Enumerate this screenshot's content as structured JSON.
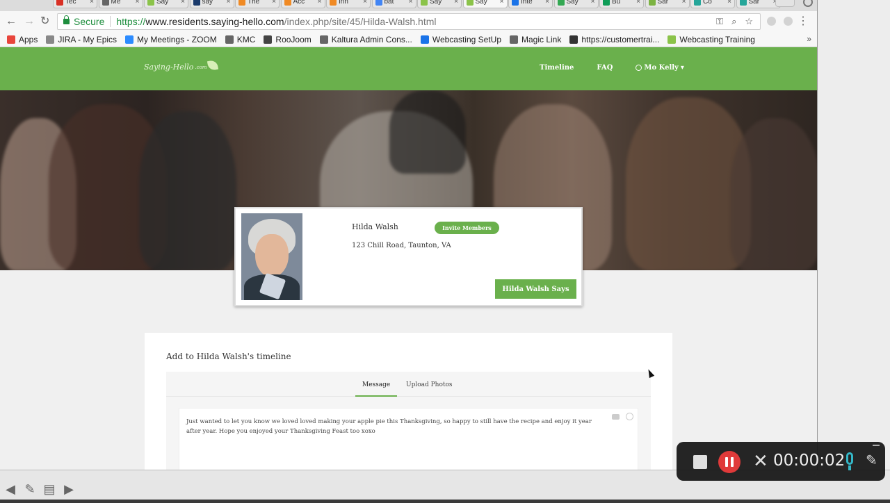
{
  "browser": {
    "tabs": [
      {
        "label": "Tec",
        "color": "#d93025",
        "active": false
      },
      {
        "label": "Me",
        "color": "#666666",
        "active": false
      },
      {
        "label": "Say",
        "color": "#8bc34a",
        "active": false
      },
      {
        "label": "say",
        "color": "#1a3a6b",
        "active": false
      },
      {
        "label": "The",
        "color": "#f08a24",
        "active": false
      },
      {
        "label": "Acc",
        "color": "#f08a24",
        "active": false
      },
      {
        "label": "Inn",
        "color": "#f08a24",
        "active": false
      },
      {
        "label": "bat",
        "color": "#4285f4",
        "active": false
      },
      {
        "label": "Say",
        "color": "#8bc34a",
        "active": false
      },
      {
        "label": "Say",
        "color": "#8bc34a",
        "active": true
      },
      {
        "label": "Inte",
        "color": "#1a73e8",
        "active": false
      },
      {
        "label": "Say",
        "color": "#34a853",
        "active": false
      },
      {
        "label": "Bu",
        "color": "#0f9d58",
        "active": false
      },
      {
        "label": "Sar",
        "color": "#7cb342",
        "active": false
      },
      {
        "label": "Co",
        "color": "#26a69a",
        "active": false
      },
      {
        "label": "Sar",
        "color": "#26a69a",
        "active": false
      }
    ],
    "tab_close": "×",
    "back": "←",
    "forward": "→",
    "reload": "↻",
    "secure_label": "Secure",
    "url_scheme": "https://",
    "url_host": "www.residents.saying-hello.com",
    "url_path": "/index.php/site/45/Hilda-Walsh.html",
    "omni_icons": [
      "key-icon",
      "zoom-icon",
      "star-icon"
    ],
    "omni_glyphs": [
      "⚿",
      "⌕",
      "☆"
    ],
    "menu": "⋮",
    "bookmarks": [
      {
        "label": "Apps",
        "color": "#e8453c"
      },
      {
        "label": "JIRA - My Epics",
        "color": "#888888"
      },
      {
        "label": "My Meetings - ZOOM",
        "color": "#2d8cff"
      },
      {
        "label": "KMC",
        "color": "#666666"
      },
      {
        "label": "RooJoom",
        "color": "#444444"
      },
      {
        "label": "Kaltura Admin Cons...",
        "color": "#666666"
      },
      {
        "label": "Webcasting SetUp",
        "color": "#1a73e8"
      },
      {
        "label": "Magic Link",
        "color": "#666666"
      },
      {
        "label": "https://customertrai...",
        "color": "#333333"
      },
      {
        "label": "Webcasting Training",
        "color": "#8bc34a"
      }
    ],
    "bookmarks_more": "»"
  },
  "site": {
    "logo_text": "Saying-Hello",
    "logo_suffix": ".com",
    "nav": {
      "timeline": "Timeline",
      "faq": "FAQ",
      "user": "Mo Kelly"
    },
    "profile": {
      "name": "Hilda Walsh",
      "invite": "Invite Members",
      "address": "123 Chill Road, Taunton, VA",
      "says_button": "Hilda Walsh Says"
    },
    "timeline": {
      "title": "Add to Hilda Walsh's timeline",
      "tabs": [
        "Message",
        "Upload Photos"
      ],
      "message": "Just wanted to let you know we loved loved making your apple pie this Thanksgiving, so happy to still have the recipe and enjoy it year after year.  Hope you enjoyed your Thanksgiving Feast too xoxo"
    }
  },
  "recorder": {
    "time": "00:00:02",
    "close": "✕",
    "pen": "✎"
  },
  "bottom_tools": [
    "◀",
    "✎",
    "▤",
    "▶"
  ],
  "colors": {
    "brand_green": "#6ab04c",
    "record_red": "#e03a3a",
    "mic_teal": "#34b8c8"
  }
}
